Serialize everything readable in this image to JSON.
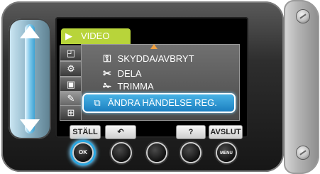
{
  "menu_title": {
    "label": "VIDEO",
    "icon": "video-camera-icon"
  },
  "mode_tabs": [
    {
      "icon": "multi-screen-icon"
    },
    {
      "icon": "settings-group-icon"
    },
    {
      "icon": "folder-icon"
    },
    {
      "icon": "edit-tools-icon"
    },
    {
      "icon": "index-screen-icon"
    }
  ],
  "menu_items": [
    {
      "label": "SKYDDA/AVBRYT",
      "icon": "key-icon",
      "glyph": "O─┐"
    },
    {
      "label": "DELA",
      "icon": "split-icon",
      "glyph": "✂"
    },
    {
      "label": "TRIMMA",
      "icon": "trim-icon",
      "glyph": "✂"
    }
  ],
  "selected_item": {
    "label": "ÄNDRA HÄNDELSE REG.",
    "icon": "change-event-icon",
    "glyph": "⧉"
  },
  "softkeys": {
    "set": "STÄLL",
    "back": "⮌",
    "help": "?",
    "quit": "AVSLUT"
  },
  "hardware_buttons": {
    "ok": "OK",
    "menu": "MENU"
  },
  "colors": {
    "title_tab": "#b8d43a",
    "selection": "#1b7fc0",
    "scroll_indicator": "#f0a040"
  }
}
